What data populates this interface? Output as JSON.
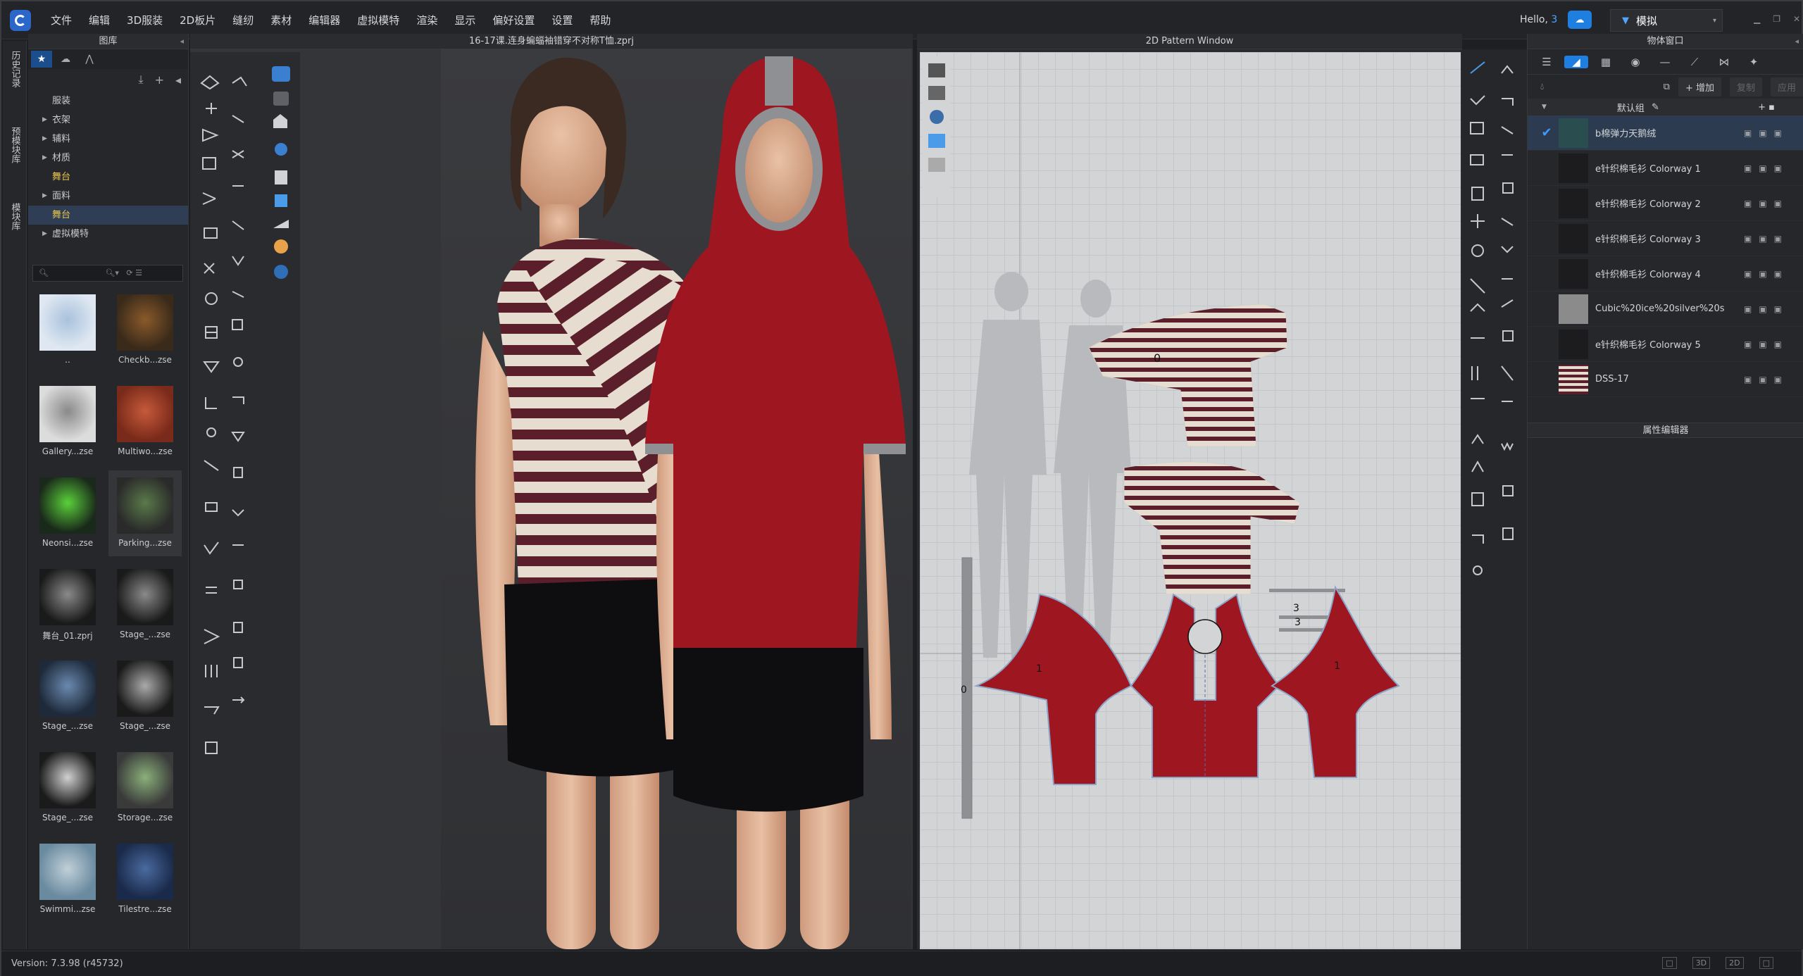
{
  "menubar": {
    "items": [
      "文件",
      "编辑",
      "3D服装",
      "2D板片",
      "缝纫",
      "素材",
      "编辑器",
      "虚拟模特",
      "渲染",
      "显示",
      "偏好设置",
      "设置",
      "帮助"
    ],
    "hello_prefix": "Hello,",
    "hello_user": "3",
    "mode_label": "模拟"
  },
  "left_tabs": [
    "历史记录",
    "预模块库",
    "模块库"
  ],
  "library": {
    "title": "图库",
    "tree": [
      {
        "label": "服装",
        "expand": false,
        "level": 0
      },
      {
        "label": "衣架",
        "expand": true,
        "level": 0
      },
      {
        "label": "辅料",
        "expand": true,
        "level": 0
      },
      {
        "label": "材质",
        "expand": true,
        "level": 0
      },
      {
        "label": "舞台",
        "expand": false,
        "level": 0,
        "highlight": true
      },
      {
        "label": "面料",
        "expand": true,
        "level": 0
      },
      {
        "label": "舞台",
        "expand": false,
        "level": 0,
        "highlight": true,
        "selected": true
      },
      {
        "label": "虚拟模特",
        "expand": true,
        "level": 0
      }
    ],
    "thumbnails": [
      {
        "label": "..",
        "kind": "folder"
      },
      {
        "label": "Checkb...zse",
        "kind": "stage"
      },
      {
        "label": "Gallery...zse",
        "kind": "gallery"
      },
      {
        "label": "Multiwo...zse",
        "kind": "multi"
      },
      {
        "label": "Neonsi...zse",
        "kind": "neon"
      },
      {
        "label": "Parking...zse",
        "kind": "parking"
      },
      {
        "label": "舞台_01.zprj",
        "kind": "light"
      },
      {
        "label": "Stage_...zse",
        "kind": "light"
      },
      {
        "label": "Stage_...zse",
        "kind": "room"
      },
      {
        "label": "Stage_...zse",
        "kind": "room2"
      },
      {
        "label": "Stage_...zse",
        "kind": "room3"
      },
      {
        "label": "Storage...zse",
        "kind": "storage"
      },
      {
        "label": "Swimmi...zse",
        "kind": "swim"
      },
      {
        "label": "Tilestre...zse",
        "kind": "tile"
      }
    ]
  },
  "viewport3d": {
    "title": "16-17课.连身蝙蝠袖错穿不对称T恤.zprj"
  },
  "viewport2d": {
    "title": "2D Pattern Window",
    "piece_labels": [
      "0",
      "1",
      "1",
      "3",
      "3",
      "3",
      "0"
    ]
  },
  "object_panel": {
    "title": "物体窗口",
    "add_label": "+ 增加",
    "copy_label": "复制",
    "delete_label": "应用",
    "group_label": "默认组",
    "fabrics": [
      {
        "name": "b棉弹力天鹅绒",
        "swatch": "#2a4d50",
        "checked": true,
        "selected": true
      },
      {
        "name": "e针织棉毛衫 Colorway 1",
        "swatch": "#1c1c1e",
        "checked": false
      },
      {
        "name": "e针织棉毛衫 Colorway 2",
        "swatch": "#1c1c1e",
        "checked": false
      },
      {
        "name": "e针织棉毛衫 Colorway 3",
        "swatch": "#1c1c1e",
        "checked": false
      },
      {
        "name": "e针织棉毛衫 Colorway 4",
        "swatch": "#1c1c1e",
        "checked": false
      },
      {
        "name": "Cubic%20ice%20silver%20s",
        "swatch": "#8b8b8b",
        "checked": false
      },
      {
        "name": "e针织棉毛衫 Colorway 5",
        "swatch": "#1c1c1e",
        "checked": false
      },
      {
        "name": "DSS-17",
        "swatch": "stripe",
        "checked": false
      }
    ],
    "property_editor": "属性编辑器"
  },
  "status": {
    "version": "Version: 7.3.98 (r45732)",
    "views": [
      "□",
      "3D",
      "2D",
      "□"
    ]
  },
  "colors": {
    "accent": "#1f7fe0",
    "garment_red": "#9e1620",
    "stripe_dark": "#5a1f2a",
    "stripe_light": "#e6ddd0"
  }
}
